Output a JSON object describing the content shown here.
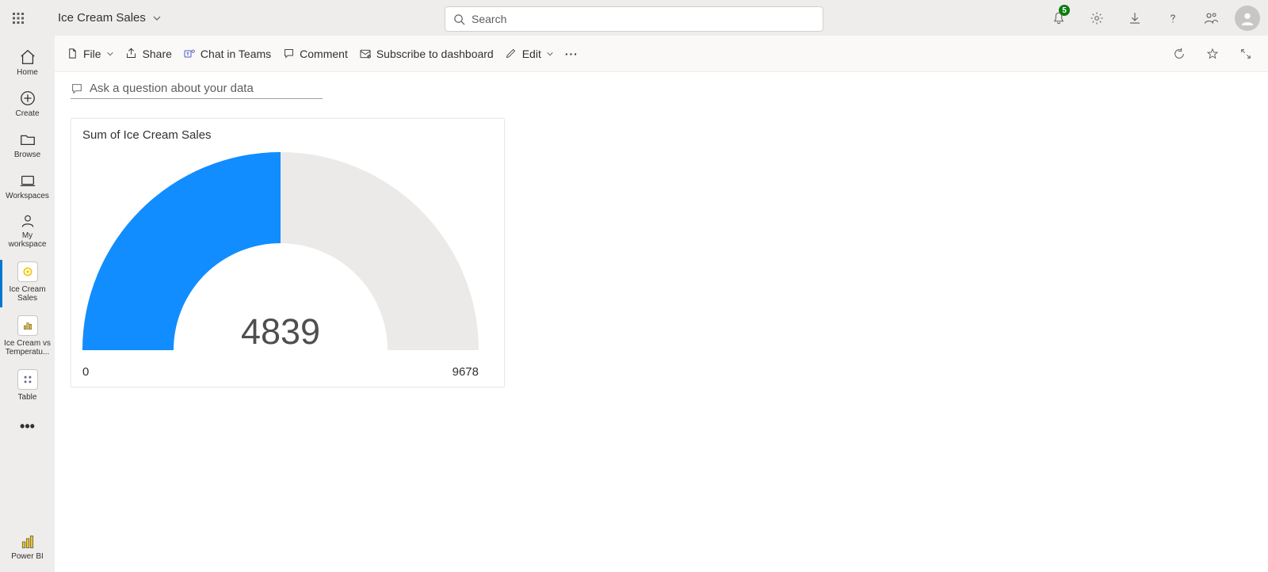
{
  "header": {
    "app_title": "Ice Cream Sales",
    "search_placeholder": "Search",
    "notification_count": "5"
  },
  "nav": {
    "home": "Home",
    "create": "Create",
    "browse": "Browse",
    "workspaces": "Workspaces",
    "my_workspace": "My\nworkspace",
    "ice_cream_sales": "Ice Cream\nSales",
    "ice_cream_vs_temp": "Ice Cream vs\nTemperatu...",
    "table": "Table",
    "power_bi": "Power BI"
  },
  "toolbar": {
    "file": "File",
    "share": "Share",
    "chat_teams": "Chat in Teams",
    "comment": "Comment",
    "subscribe": "Subscribe to dashboard",
    "edit": "Edit"
  },
  "qna_placeholder": "Ask a question about your data",
  "chart_data": {
    "type": "gauge",
    "title": "Sum of Ice Cream Sales",
    "value": 4839,
    "min": 0,
    "max": 9678,
    "arc_color": "#118dff",
    "track_color": "#eceae8"
  }
}
